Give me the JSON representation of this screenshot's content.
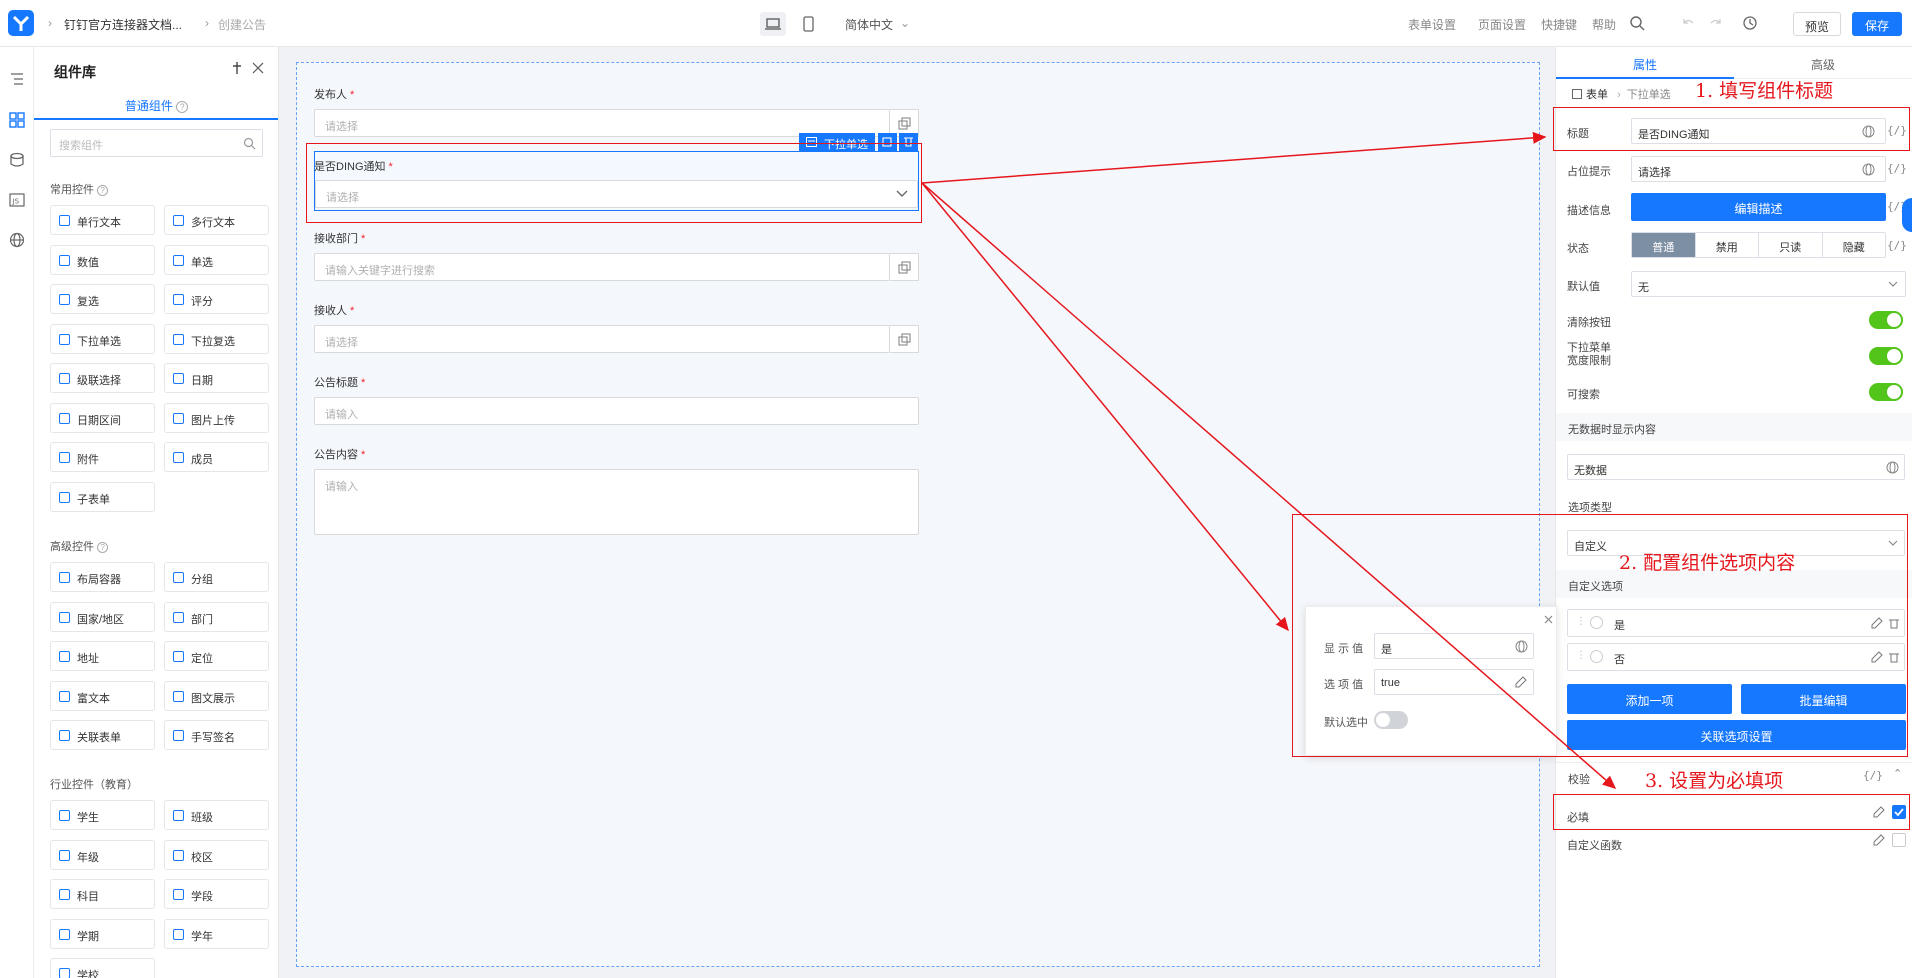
{
  "topbar": {
    "breadcrumb_app": "钉钉官方连接器文档...",
    "breadcrumb_page": "创建公告",
    "language": "简体中文",
    "links": [
      "表单设置",
      "页面设置",
      "快捷键",
      "帮助"
    ],
    "preview_label": "预览",
    "save_label": "保存"
  },
  "library": {
    "title": "组件库",
    "tab_label": "普通组件",
    "search_placeholder": "搜索组件",
    "common_title": "常用控件",
    "common_items": [
      "单行文本",
      "多行文本",
      "数值",
      "单选",
      "复选",
      "评分",
      "下拉单选",
      "下拉复选",
      "级联选择",
      "日期",
      "日期区间",
      "图片上传",
      "附件",
      "成员",
      "子表单"
    ],
    "advanced_title": "高级控件",
    "advanced_items": [
      "布局容器",
      "分组",
      "国家/地区",
      "部门",
      "地址",
      "定位",
      "富文本",
      "图文展示",
      "关联表单",
      "手写签名"
    ],
    "industry_title": "行业控件（教育）",
    "industry_items": [
      "学生",
      "班级",
      "年级",
      "校区",
      "科目",
      "学段",
      "学期",
      "学年",
      "学校"
    ]
  },
  "form": {
    "fields": [
      {
        "label": "发布人",
        "placeholder": "请选择"
      },
      {
        "label": "是否DING通知",
        "placeholder": "请选择"
      },
      {
        "label": "接收部门",
        "placeholder": "请输入关键字进行搜索"
      },
      {
        "label": "接收人",
        "placeholder": "请选择"
      },
      {
        "label": "公告标题",
        "placeholder": "请输入"
      },
      {
        "label": "公告内容",
        "placeholder": "请输入"
      }
    ],
    "required_mark": "*",
    "selected_tag": "下拉单选"
  },
  "props": {
    "tab_attr": "属性",
    "tab_advanced": "高级",
    "crumb_form": "表单",
    "crumb_component": "下拉单选",
    "title_label": "标题",
    "title_value": "是否DING通知",
    "placeholder_label": "占位提示",
    "placeholder_value": "请选择",
    "desc_label": "描述信息",
    "desc_button": "编辑描述",
    "state_label": "状态",
    "state_options": [
      "普通",
      "禁用",
      "只读",
      "隐藏"
    ],
    "default_label": "默认值",
    "default_value": "无",
    "clear_label": "清除按钮",
    "dropdown_width_label": "下拉菜单宽度限制",
    "searchable_label": "可搜索",
    "empty_section": "无数据时显示内容",
    "empty_value": "无数据",
    "option_type_section": "选项类型",
    "option_type_value": "自定义",
    "custom_options_section": "自定义选项",
    "custom_options": [
      "是",
      "否"
    ],
    "add_option": "添加一项",
    "bulk_edit": "批量编辑",
    "linked_options": "关联选项设置",
    "validation_section": "校验",
    "required_label": "必填",
    "custom_func_label": "自定义函数",
    "brace": "{/}"
  },
  "popup": {
    "display_label": "显 示 值",
    "display_value": "是",
    "option_label": "选 项 值",
    "option_value": "true",
    "default_checked_label": "默认选中"
  },
  "annotations": {
    "step1": "1. 填写组件标题",
    "step2": "2. 配置组件选项内容",
    "step3": "3. 设置为必填项"
  },
  "colors": {
    "accent": "#1677ff",
    "annotation": "#e5171d",
    "toggle_on": "#52c41a"
  }
}
